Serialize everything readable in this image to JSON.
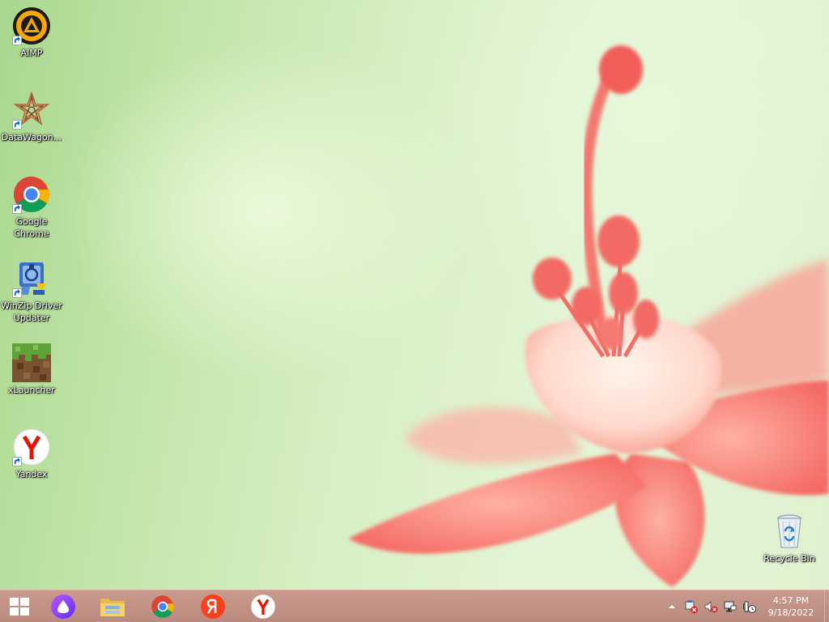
{
  "desktop": {
    "icons": [
      {
        "label": "AIMP",
        "icon": "aimp-icon",
        "shortcut": true
      },
      {
        "label": "DataWagon...",
        "icon": "datawagon-icon",
        "shortcut": true
      },
      {
        "label": "Google Chrome",
        "icon": "chrome-icon",
        "shortcut": true
      },
      {
        "label": "WinZip Driver Updater",
        "icon": "winzip-driver-updater-icon",
        "shortcut": true
      },
      {
        "label": "xLauncher",
        "icon": "xlauncher-icon",
        "shortcut": false
      },
      {
        "label": "Yandex",
        "icon": "yandex-browser-icon",
        "shortcut": true
      },
      {
        "label": "Recycle Bin",
        "icon": "recycle-bin-icon",
        "shortcut": false
      }
    ]
  },
  "taskbar": {
    "pinned": [
      {
        "name": "start-button",
        "icon": "windows-logo-icon"
      },
      {
        "name": "alice-button",
        "icon": "alice-icon"
      },
      {
        "name": "file-explorer-button",
        "icon": "file-explorer-icon"
      },
      {
        "name": "chrome-button",
        "icon": "chrome-icon"
      },
      {
        "name": "yandex-ya-button",
        "icon": "yandex-ya-icon"
      },
      {
        "name": "yandex-browser-button",
        "icon": "yandex-browser-icon"
      }
    ],
    "tray": {
      "icons": [
        "show-hidden-icons-chevron",
        "action-center-warning-icon",
        "volume-muted-icon",
        "network-icon",
        "power-icon"
      ]
    },
    "clock": {
      "time": "4:57 PM",
      "date": "9/18/2022"
    }
  },
  "colors": {
    "taskbar": "#c1928a",
    "wallpaper_green": "#c4e6ad",
    "flower_pink": "#f47a72"
  }
}
